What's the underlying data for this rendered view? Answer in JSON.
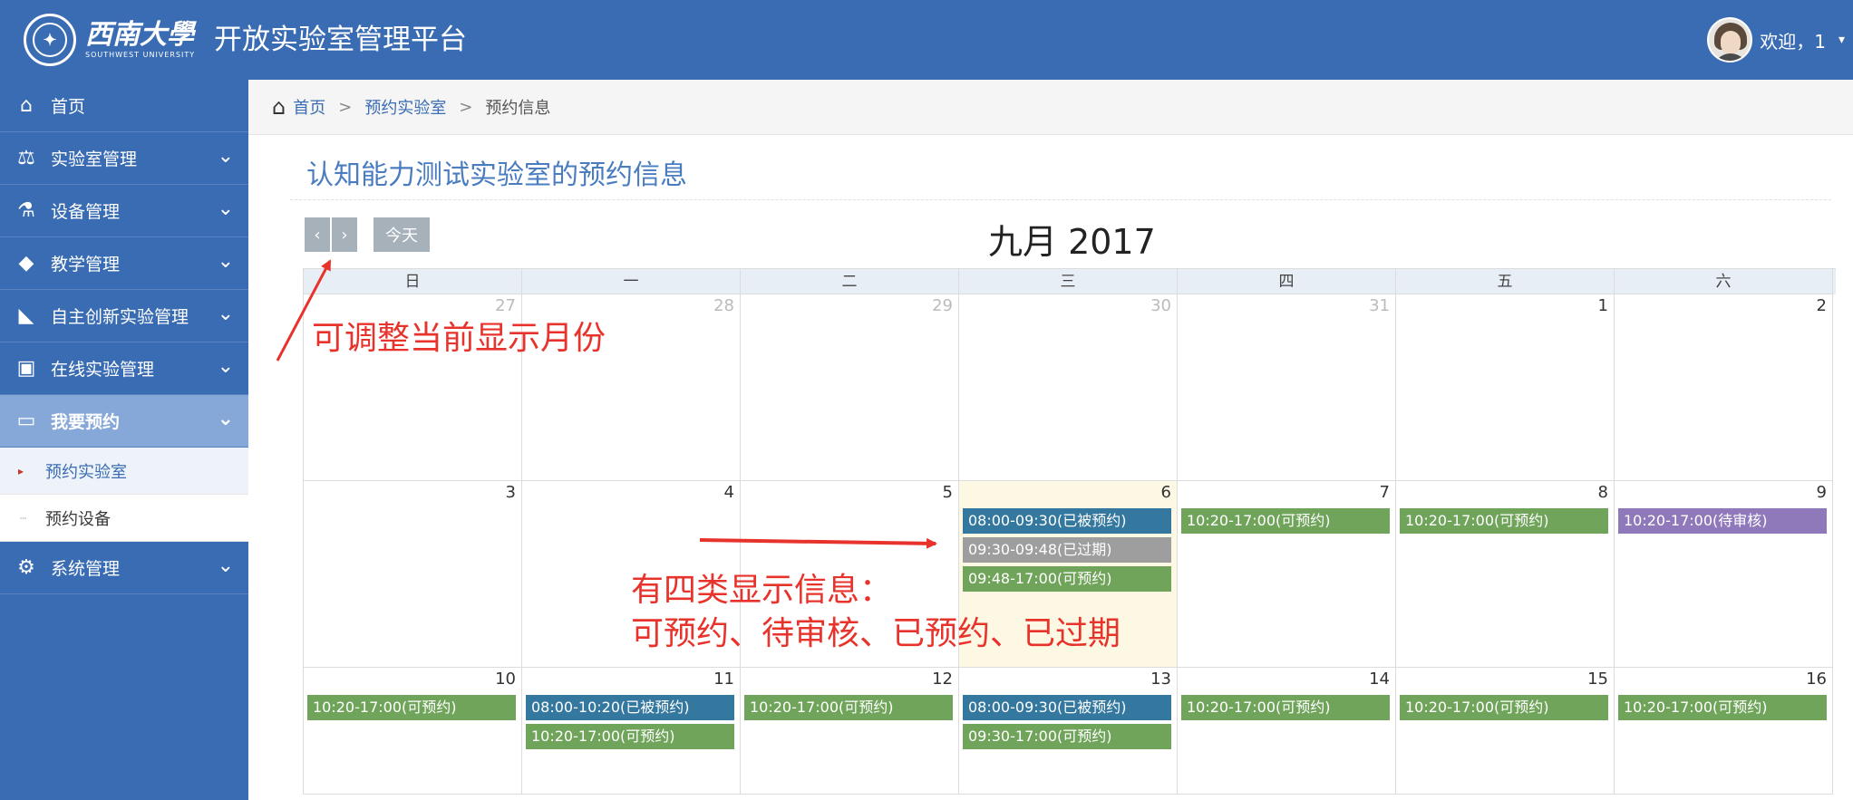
{
  "header": {
    "logo_cn": "西南大學",
    "logo_en": "SOUTHWEST UNIVERSITY",
    "app_title": "开放实验室管理平台",
    "welcome": "欢迎，1"
  },
  "sidebar": {
    "items": [
      {
        "label": "首页",
        "icon": "home-icon",
        "glyph": "🏠"
      },
      {
        "label": "实验室管理",
        "icon": "scale-icon",
        "glyph": "⚖"
      },
      {
        "label": "设备管理",
        "icon": "flask-icon",
        "glyph": "⚗"
      },
      {
        "label": "教学管理",
        "icon": "graduation-cap-icon",
        "glyph": "🎓"
      },
      {
        "label": "自主创新实验管理",
        "icon": "area-chart-icon",
        "glyph": "📈"
      },
      {
        "label": "在线实验管理",
        "icon": "file-video-icon",
        "glyph": "📄"
      },
      {
        "label": "我要预约",
        "icon": "monitor-icon",
        "glyph": "🖥"
      },
      {
        "label": "系统管理",
        "icon": "gears-icon",
        "glyph": "⚙"
      }
    ],
    "subitems": [
      {
        "label": "预约实验室"
      },
      {
        "label": "预约设备"
      }
    ]
  },
  "breadcrumb": {
    "items": [
      "首页",
      "预约实验室",
      "预约信息"
    ],
    "sep": ">"
  },
  "page": {
    "title": "认知能力测试实验室的预约信息"
  },
  "calendar": {
    "prev_label": "‹",
    "next_label": "›",
    "today_label": "今天",
    "month_title": "九月 2017",
    "weekdays": [
      "日",
      "一",
      "二",
      "三",
      "四",
      "五",
      "六"
    ],
    "weeks": [
      [
        {
          "day": "27",
          "other": true,
          "events": []
        },
        {
          "day": "28",
          "other": true,
          "events": []
        },
        {
          "day": "29",
          "other": true,
          "events": []
        },
        {
          "day": "30",
          "other": true,
          "events": []
        },
        {
          "day": "31",
          "other": true,
          "events": []
        },
        {
          "day": "1",
          "events": []
        },
        {
          "day": "2",
          "events": []
        }
      ],
      [
        {
          "day": "3",
          "events": []
        },
        {
          "day": "4",
          "events": []
        },
        {
          "day": "5",
          "events": []
        },
        {
          "day": "6",
          "today": true,
          "events": [
            {
              "text": "08:00-09:30(已被预约)",
              "status": "booked"
            },
            {
              "text": "09:30-09:48(已过期)",
              "status": "expired"
            },
            {
              "text": "09:48-17:00(可预约)",
              "status": "available"
            }
          ]
        },
        {
          "day": "7",
          "events": [
            {
              "text": "10:20-17:00(可预约)",
              "status": "available"
            }
          ]
        },
        {
          "day": "8",
          "events": [
            {
              "text": "10:20-17:00(可预约)",
              "status": "available"
            }
          ]
        },
        {
          "day": "9",
          "events": [
            {
              "text": "10:20-17:00(待审核)",
              "status": "pending"
            }
          ]
        }
      ],
      [
        {
          "day": "10",
          "events": [
            {
              "text": "10:20-17:00(可预约)",
              "status": "available"
            }
          ]
        },
        {
          "day": "11",
          "events": [
            {
              "text": "08:00-10:20(已被预约)",
              "status": "booked"
            },
            {
              "text": "10:20-17:00(可预约)",
              "status": "available"
            }
          ]
        },
        {
          "day": "12",
          "events": [
            {
              "text": "10:20-17:00(可预约)",
              "status": "available"
            }
          ]
        },
        {
          "day": "13",
          "events": [
            {
              "text": "08:00-09:30(已被预约)",
              "status": "booked"
            },
            {
              "text": "09:30-17:00(可预约)",
              "status": "available"
            }
          ]
        },
        {
          "day": "14",
          "events": [
            {
              "text": "10:20-17:00(可预约)",
              "status": "available"
            }
          ]
        },
        {
          "day": "15",
          "events": [
            {
              "text": "10:20-17:00(可预约)",
              "status": "available"
            }
          ]
        },
        {
          "day": "16",
          "events": [
            {
              "text": "10:20-17:00(可预约)",
              "status": "available"
            }
          ]
        }
      ]
    ],
    "status_colors": {
      "booked": "#35789f",
      "expired": "#9e9e9e",
      "available": "#71a45b",
      "pending": "#8f79bb"
    }
  },
  "annotations": {
    "month_note": "可调整当前显示月份",
    "info_line1": "有四类显示信息：",
    "info_line2": "可预约、待审核、已预约、已过期",
    "color": "#e8332c"
  },
  "colors": {
    "header_bg": "#3a6cb3",
    "sidebar_active": "#86a8d8",
    "today_bg": "#fcf8e3"
  }
}
